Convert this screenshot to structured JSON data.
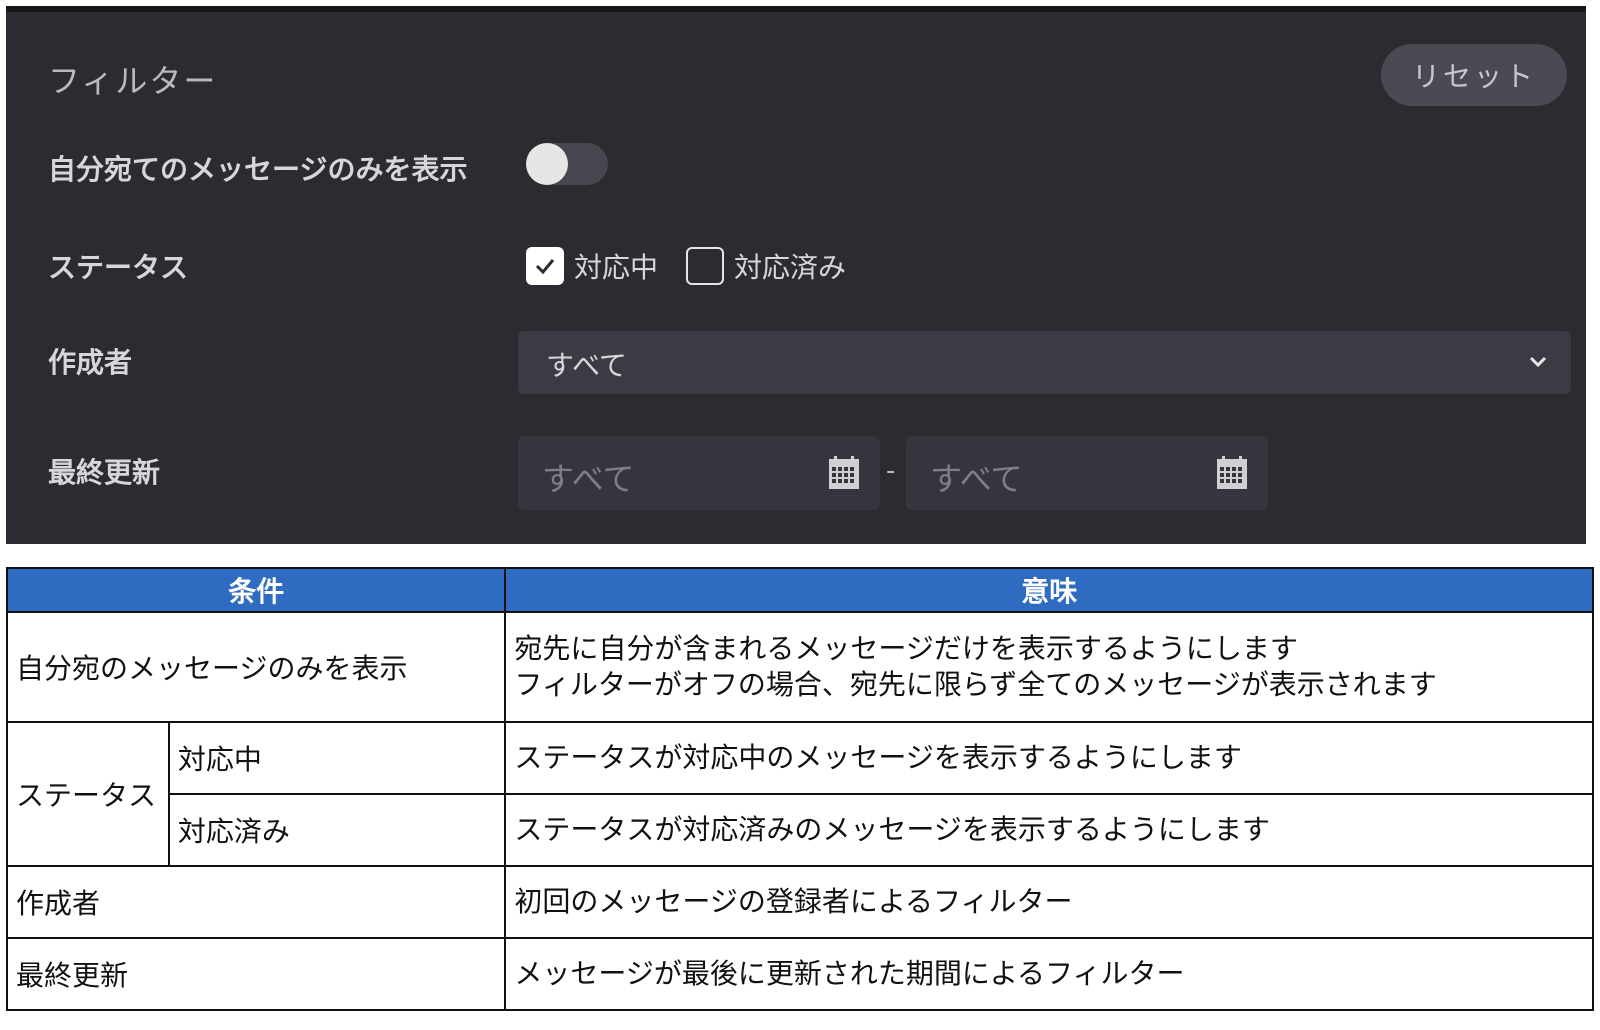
{
  "filter": {
    "title": "フィルター",
    "reset_label": "リセット",
    "only_mine": {
      "label": "自分宛てのメッセージのみを表示",
      "enabled": false
    },
    "status": {
      "label": "ステータス",
      "options": [
        {
          "label": "対応中",
          "checked": true
        },
        {
          "label": "対応済み",
          "checked": false
        }
      ]
    },
    "creator": {
      "label": "作成者",
      "selected": "すべて"
    },
    "last_updated": {
      "label": "最終更新",
      "from_placeholder": "すべて",
      "to_placeholder": "すべて",
      "separator": "-"
    }
  },
  "table": {
    "headers": {
      "condition": "条件",
      "meaning": "意味"
    },
    "rows": {
      "only_mine": {
        "condition": "自分宛のメッセージのみを表示",
        "meaning_line1": "宛先に自分が含まれるメッセージだけを表示するようにします",
        "meaning_line2": "フィルターがオフの場合、宛先に限らず全てのメッセージが表示されます"
      },
      "status": {
        "condition": "ステータス",
        "in_progress": {
          "condition": "対応中",
          "meaning": "ステータスが対応中のメッセージを表示するようにします"
        },
        "done": {
          "condition": "対応済み",
          "meaning": "ステータスが対応済みのメッセージを表示するようにします"
        }
      },
      "creator": {
        "condition": "作成者",
        "meaning": "初回のメッセージの登録者によるフィルター"
      },
      "last_updated": {
        "condition": "最終更新",
        "meaning": "メッセージが最後に更新された期間によるフィルター"
      }
    }
  },
  "icons": {
    "checkmark": "check-icon",
    "chevron": "chevron-down-icon",
    "calendar": "calendar-icon"
  },
  "colors": {
    "panel_bg": "#2b2c31",
    "table_header_bg": "#2f6cc1"
  }
}
